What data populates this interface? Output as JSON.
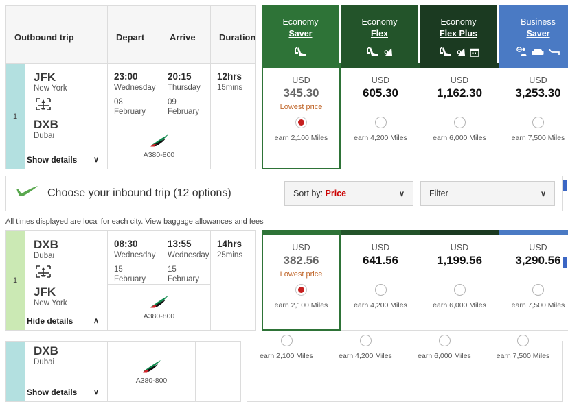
{
  "outbound_header": {
    "trip_label": "Outbound trip",
    "depart_label": "Depart",
    "arrive_label": "Arrive",
    "duration_label": "Duration"
  },
  "fare_classes": [
    {
      "cabin": "Economy",
      "tier": "Saver",
      "color": "#2e7337",
      "icons": [
        "seat-icon"
      ]
    },
    {
      "cabin": "Economy",
      "tier": "Flex",
      "color": "#23542a",
      "icons": [
        "seat-icon",
        "baggage-icon"
      ]
    },
    {
      "cabin": "Economy",
      "tier": "Flex Plus",
      "color": "#1b3a21",
      "icons": [
        "seat-icon",
        "baggage-icon",
        "calendar-icon"
      ]
    },
    {
      "cabin": "Business",
      "tier": "Saver",
      "color": "#4a7ac4",
      "icons": [
        "priority-icon",
        "armchair-icon",
        "lieflat-bed-icon"
      ]
    }
  ],
  "outbound_flight": {
    "index": "1",
    "origin_code": "JFK",
    "origin_city": "New York",
    "dest_code": "DXB",
    "dest_city": "Dubai",
    "depart_time": "23:00",
    "depart_dow": "Wednesday",
    "depart_date": "08 February",
    "arrive_time": "20:15",
    "arrive_dow": "Thursday",
    "arrive_date": "09 February",
    "duration_hours": "12hrs",
    "duration_mins": "15mins",
    "aircraft": "A380-800",
    "details_label": "Show details",
    "details_chevron": "∨",
    "prices": [
      {
        "currency": "USD",
        "amount": "345.30",
        "lowest_label": "Lowest price",
        "selected": true,
        "miles": "earn 2,100 Miles"
      },
      {
        "currency": "USD",
        "amount": "605.30",
        "lowest_label": "",
        "selected": false,
        "miles": "earn 4,200 Miles"
      },
      {
        "currency": "USD",
        "amount": "1,162.30",
        "lowest_label": "",
        "selected": false,
        "miles": "earn 6,000 Miles"
      },
      {
        "currency": "USD",
        "amount": "3,253.30",
        "lowest_label": "",
        "selected": false,
        "miles": "earn 7,500 Miles"
      }
    ]
  },
  "inbound_banner": {
    "title": "Choose your inbound trip (12 options)",
    "sort_prefix": "Sort by: ",
    "sort_value": "Price",
    "sort_chevron": "∨",
    "filter_label": "Filter",
    "filter_chevron": "∨"
  },
  "notice": "All times displayed are local for each city. View baggage allowances and fees",
  "inbound_flight": {
    "index": "1",
    "origin_code": "DXB",
    "origin_city": "Dubai",
    "dest_code": "JFK",
    "dest_city": "New York",
    "depart_time": "08:30",
    "depart_dow": "Wednesday",
    "depart_date": "15 February",
    "arrive_time": "13:55",
    "arrive_dow": "Wednesday",
    "arrive_date": "15 February",
    "duration_hours": "14hrs",
    "duration_mins": "25mins",
    "aircraft": "A380-800",
    "details_label": "Hide details",
    "details_chevron": "∧",
    "prices": [
      {
        "currency": "USD",
        "amount": "382.56",
        "lowest_label": "Lowest price",
        "selected": true,
        "miles": "earn 2,100 Miles"
      },
      {
        "currency": "USD",
        "amount": "641.56",
        "lowest_label": "",
        "selected": false,
        "miles": "earn 4,200 Miles"
      },
      {
        "currency": "USD",
        "amount": "1,199.56",
        "lowest_label": "",
        "selected": false,
        "miles": "earn 6,000 Miles"
      },
      {
        "currency": "USD",
        "amount": "3,290.56",
        "lowest_label": "",
        "selected": false,
        "miles": "earn 7,500 Miles"
      }
    ]
  },
  "inbound_flight_partial": {
    "origin_code": "DXB",
    "origin_city": "Dubai",
    "aircraft": "A380-800",
    "details_label": "Show details",
    "details_chevron": "∨",
    "prices": [
      {
        "miles": "earn 2,100 Miles"
      },
      {
        "miles": "earn 4,200 Miles"
      },
      {
        "miles": "earn 6,000 Miles"
      },
      {
        "miles": "earn 7,500 Miles"
      }
    ]
  },
  "colors": {
    "band_teal": "#b3e0e0",
    "band_green": "#cbe9b4",
    "lowest_price": "#c0662a",
    "radio_fill": "#c62020",
    "accent_red": "#cc0000",
    "scrollbar": "#3b66c4"
  }
}
